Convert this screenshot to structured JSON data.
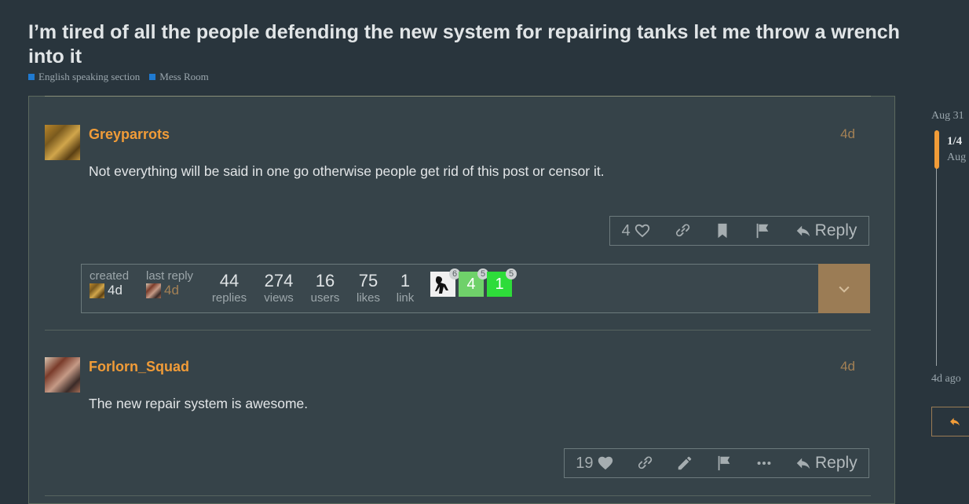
{
  "topic": {
    "title": "I’m tired of all the people defending the new system for repairing tanks let me throw a wrench into it",
    "categories": [
      {
        "name": "English speaking section",
        "color": "#1f7ad1"
      },
      {
        "name": "Mess Room",
        "color": "#1f7ad1"
      }
    ]
  },
  "posts": [
    {
      "username": "Greyparrots",
      "date": "4d",
      "body": "Not everything will be said in one go otherwise people get rid of this post or censor it.",
      "likes": "4",
      "reply_label": "Reply"
    },
    {
      "username": "Forlorn_Squad",
      "date": "4d",
      "body": "The new repair system is awesome.",
      "likes": "19",
      "reply_label": "Reply"
    }
  ],
  "summary": {
    "created_label": "created",
    "created_value": "4d",
    "last_reply_label": "last reply",
    "last_reply_value": "4d",
    "replies": {
      "value": "44",
      "label": "replies"
    },
    "views": {
      "value": "274",
      "label": "views"
    },
    "users": {
      "value": "16",
      "label": "users"
    },
    "likes": {
      "value": "75",
      "label": "likes"
    },
    "links": {
      "value": "1",
      "label": "link"
    },
    "participants": [
      {
        "count": "6",
        "letter": ""
      },
      {
        "count": "5",
        "letter": "4"
      },
      {
        "count": "5",
        "letter": "1"
      }
    ]
  },
  "timeline": {
    "start_date": "Aug 31",
    "position": "1/4",
    "position_sub": "Aug",
    "end_date": "4d ago"
  },
  "colors": {
    "accent": "#f19c38",
    "date": "#a48155",
    "expand_button": "#9b7c55"
  }
}
